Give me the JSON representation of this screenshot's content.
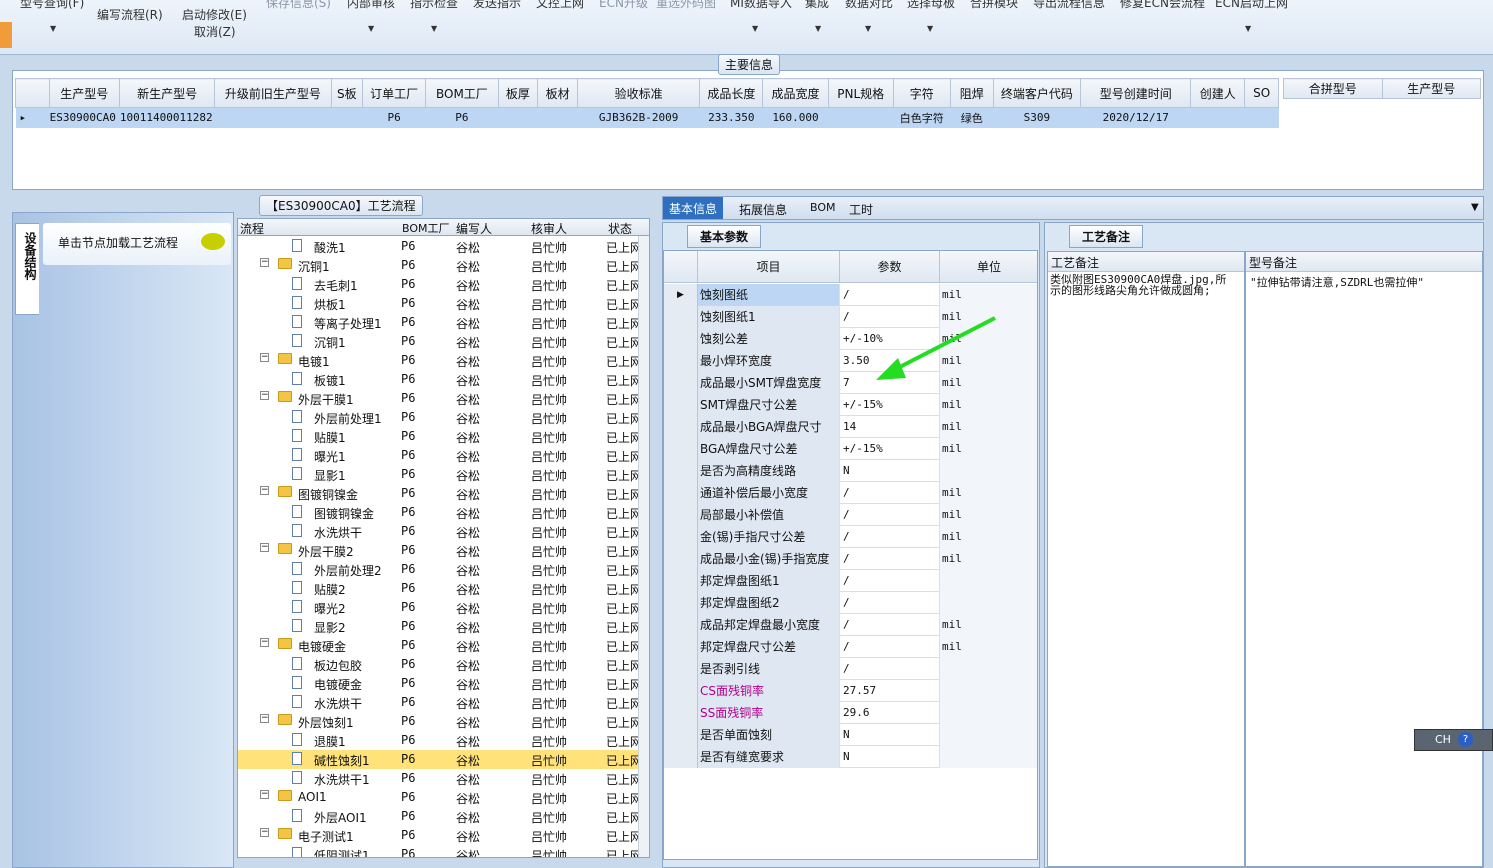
{
  "ribbon": {
    "buttons": [
      "型号查询(F)",
      "编写流程(R)",
      "启动修改(E)",
      "取消(Z)",
      "保存信息(S)",
      "内部审核",
      "指示检查",
      "发送指示",
      "文控上网",
      "ECN升级",
      "重选外码图",
      "MI数据导入",
      "集成",
      "数据对比",
      "选择母板",
      "合拼模块",
      "导出流程信息",
      "修复ECN会流程",
      "ECN启动上网"
    ]
  },
  "main_info": {
    "title": "主要信息",
    "columns": [
      "生产型号",
      "新生产型号",
      "升级前旧生产型号",
      "S板",
      "订单工厂",
      "BOM工厂",
      "板厚",
      "板材",
      "验收标准",
      "成品长度",
      "成品宽度",
      "PNL规格",
      "字符",
      "阻焊",
      "终端客户代码",
      "型号创建时间",
      "创建人",
      "SO"
    ],
    "row": [
      "ES30900CA0",
      "10011400011282",
      "",
      "",
      "P6",
      "P6",
      "",
      "",
      "GJB362B-2009",
      "233.350",
      "160.000",
      "",
      "白色字符",
      "绿色",
      "S309",
      "2020/12/17",
      "",
      ""
    ],
    "merge_columns": [
      "合拼型号",
      "生产型号"
    ]
  },
  "left_tab": {
    "vertical_label": "设备结构",
    "hint": "单击节点加载工艺流程"
  },
  "flow": {
    "title": "【ES30900CA0】工艺流程",
    "columns": [
      "流程",
      "BOM工厂",
      "编写人",
      "核审人",
      "状态"
    ],
    "rows": [
      {
        "level": 1,
        "type": "doc",
        "name": "酸洗1",
        "bom": "P6",
        "writer": "谷松",
        "reviewer": "吕忙帅",
        "status": "已上网"
      },
      {
        "level": 0,
        "type": "folder",
        "name": "沉铜1",
        "bom": "P6",
        "writer": "谷松",
        "reviewer": "吕忙帅",
        "status": "已上网"
      },
      {
        "level": 1,
        "type": "doc",
        "name": "去毛刺1",
        "bom": "P6",
        "writer": "谷松",
        "reviewer": "吕忙帅",
        "status": "已上网"
      },
      {
        "level": 1,
        "type": "doc",
        "name": "烘板1",
        "bom": "P6",
        "writer": "谷松",
        "reviewer": "吕忙帅",
        "status": "已上网"
      },
      {
        "level": 1,
        "type": "doc",
        "name": "等离子处理1",
        "bom": "P6",
        "writer": "谷松",
        "reviewer": "吕忙帅",
        "status": "已上网"
      },
      {
        "level": 1,
        "type": "doc",
        "name": "沉铜1",
        "bom": "P6",
        "writer": "谷松",
        "reviewer": "吕忙帅",
        "status": "已上网"
      },
      {
        "level": 0,
        "type": "folder",
        "name": "电镀1",
        "bom": "P6",
        "writer": "谷松",
        "reviewer": "吕忙帅",
        "status": "已上网"
      },
      {
        "level": 1,
        "type": "doc",
        "name": "板镀1",
        "bom": "P6",
        "writer": "谷松",
        "reviewer": "吕忙帅",
        "status": "已上网"
      },
      {
        "level": 0,
        "type": "folder",
        "name": "外层干膜1",
        "bom": "P6",
        "writer": "谷松",
        "reviewer": "吕忙帅",
        "status": "已上网"
      },
      {
        "level": 1,
        "type": "doc",
        "name": "外层前处理1",
        "bom": "P6",
        "writer": "谷松",
        "reviewer": "吕忙帅",
        "status": "已上网"
      },
      {
        "level": 1,
        "type": "doc",
        "name": "贴膜1",
        "bom": "P6",
        "writer": "谷松",
        "reviewer": "吕忙帅",
        "status": "已上网"
      },
      {
        "level": 1,
        "type": "doc",
        "name": "曝光1",
        "bom": "P6",
        "writer": "谷松",
        "reviewer": "吕忙帅",
        "status": "已上网"
      },
      {
        "level": 1,
        "type": "doc",
        "name": "显影1",
        "bom": "P6",
        "writer": "谷松",
        "reviewer": "吕忙帅",
        "status": "已上网"
      },
      {
        "level": 0,
        "type": "folder",
        "name": "图镀铜镍金",
        "bom": "P6",
        "writer": "谷松",
        "reviewer": "吕忙帅",
        "status": "已上网"
      },
      {
        "level": 1,
        "type": "doc",
        "name": "图镀铜镍金",
        "bom": "P6",
        "writer": "谷松",
        "reviewer": "吕忙帅",
        "status": "已上网"
      },
      {
        "level": 1,
        "type": "doc",
        "name": "水洗烘干",
        "bom": "P6",
        "writer": "谷松",
        "reviewer": "吕忙帅",
        "status": "已上网"
      },
      {
        "level": 0,
        "type": "folder",
        "name": "外层干膜2",
        "bom": "P6",
        "writer": "谷松",
        "reviewer": "吕忙帅",
        "status": "已上网"
      },
      {
        "level": 1,
        "type": "doc",
        "name": "外层前处理2",
        "bom": "P6",
        "writer": "谷松",
        "reviewer": "吕忙帅",
        "status": "已上网"
      },
      {
        "level": 1,
        "type": "doc",
        "name": "贴膜2",
        "bom": "P6",
        "writer": "谷松",
        "reviewer": "吕忙帅",
        "status": "已上网"
      },
      {
        "level": 1,
        "type": "doc",
        "name": "曝光2",
        "bom": "P6",
        "writer": "谷松",
        "reviewer": "吕忙帅",
        "status": "已上网"
      },
      {
        "level": 1,
        "type": "doc",
        "name": "显影2",
        "bom": "P6",
        "writer": "谷松",
        "reviewer": "吕忙帅",
        "status": "已上网"
      },
      {
        "level": 0,
        "type": "folder",
        "name": "电镀硬金",
        "bom": "P6",
        "writer": "谷松",
        "reviewer": "吕忙帅",
        "status": "已上网"
      },
      {
        "level": 1,
        "type": "doc",
        "name": "板边包胶",
        "bom": "P6",
        "writer": "谷松",
        "reviewer": "吕忙帅",
        "status": "已上网"
      },
      {
        "level": 1,
        "type": "doc",
        "name": "电镀硬金",
        "bom": "P6",
        "writer": "谷松",
        "reviewer": "吕忙帅",
        "status": "已上网"
      },
      {
        "level": 1,
        "type": "doc",
        "name": "水洗烘干",
        "bom": "P6",
        "writer": "谷松",
        "reviewer": "吕忙帅",
        "status": "已上网"
      },
      {
        "level": 0,
        "type": "folder",
        "name": "外层蚀刻1",
        "bom": "P6",
        "writer": "谷松",
        "reviewer": "吕忙帅",
        "status": "已上网"
      },
      {
        "level": 1,
        "type": "doc",
        "name": "退膜1",
        "bom": "P6",
        "writer": "谷松",
        "reviewer": "吕忙帅",
        "status": "已上网"
      },
      {
        "level": 1,
        "type": "doc",
        "name": "碱性蚀刻1",
        "bom": "P6",
        "writer": "谷松",
        "reviewer": "吕忙帅",
        "status": "已上网",
        "selected": true
      },
      {
        "level": 1,
        "type": "doc",
        "name": "水洗烘干1",
        "bom": "P6",
        "writer": "谷松",
        "reviewer": "吕忙帅",
        "status": "已上网"
      },
      {
        "level": 0,
        "type": "folder",
        "name": "AOI1",
        "bom": "P6",
        "writer": "谷松",
        "reviewer": "吕忙帅",
        "status": "已上网"
      },
      {
        "level": 1,
        "type": "doc",
        "name": "外层AOI1",
        "bom": "P6",
        "writer": "谷松",
        "reviewer": "吕忙帅",
        "status": "已上网"
      },
      {
        "level": 0,
        "type": "folder",
        "name": "电子测试1",
        "bom": "P6",
        "writer": "谷松",
        "reviewer": "吕忙帅",
        "status": "已上网"
      },
      {
        "level": 1,
        "type": "doc",
        "name": "低阻测试1",
        "bom": "P6",
        "writer": "谷松",
        "reviewer": "吕忙帅",
        "status": "已上网"
      }
    ]
  },
  "detail": {
    "tabs": [
      "基本信息",
      "拓展信息",
      "BOM",
      "工时"
    ],
    "subtab": "基本参数",
    "columns": [
      "项目",
      "参数",
      "单位"
    ],
    "rows": [
      {
        "item": "蚀刻图纸",
        "value": "/",
        "unit": "mil"
      },
      {
        "item": "蚀刻图纸1",
        "value": "/",
        "unit": "mil"
      },
      {
        "item": "蚀刻公差",
        "value": "+/-10%",
        "unit": "mil"
      },
      {
        "item": "最小焊环宽度",
        "value": "3.50",
        "unit": "mil"
      },
      {
        "item": "成品最小SMT焊盘宽度",
        "value": "7",
        "unit": "mil"
      },
      {
        "item": "SMT焊盘尺寸公差",
        "value": "+/-15%",
        "unit": "mil"
      },
      {
        "item": "成品最小BGA焊盘尺寸",
        "value": "14",
        "unit": "mil"
      },
      {
        "item": "BGA焊盘尺寸公差",
        "value": "+/-15%",
        "unit": "mil"
      },
      {
        "item": "是否为高精度线路",
        "value": "N",
        "unit": ""
      },
      {
        "item": "通道补偿后最小宽度",
        "value": "/",
        "unit": "mil"
      },
      {
        "item": "局部最小补偿值",
        "value": "/",
        "unit": "mil"
      },
      {
        "item": "金(锡)手指尺寸公差",
        "value": "/",
        "unit": "mil"
      },
      {
        "item": "成品最小金(锡)手指宽度",
        "value": "/",
        "unit": "mil"
      },
      {
        "item": "邦定焊盘图纸1",
        "value": "/",
        "unit": ""
      },
      {
        "item": "邦定焊盘图纸2",
        "value": "/",
        "unit": ""
      },
      {
        "item": "成品邦定焊盘最小宽度",
        "value": "/",
        "unit": "mil"
      },
      {
        "item": "邦定焊盘尺寸公差",
        "value": "/",
        "unit": "mil"
      },
      {
        "item": "是否剥引线",
        "value": "/",
        "unit": ""
      },
      {
        "item": "CS面残铜率",
        "value": "27.57",
        "unit": "",
        "magenta": true
      },
      {
        "item": "SS面残铜率",
        "value": "29.6",
        "unit": "",
        "magenta": true
      },
      {
        "item": "是否单面蚀刻",
        "value": "N",
        "unit": ""
      },
      {
        "item": "是否有缝宽要求",
        "value": "N",
        "unit": ""
      }
    ]
  },
  "notes": {
    "tab": "工艺备注",
    "col1": "工艺备注",
    "col2": "型号备注",
    "text1": "类似附图ES30900CA0焊盘.jpg,所示的图形线路尖角允许做成圆角;",
    "text2": "\"拉伸钻带请注意,SZDRL也需拉伸\""
  },
  "ime": {
    "label": "CH"
  },
  "colors": {
    "accent": "#2f6fbf",
    "selected_row": "#bcd6f3",
    "highlight": "#ffe27a",
    "arrow": "#22dd22",
    "magenta": "#b0008a"
  }
}
